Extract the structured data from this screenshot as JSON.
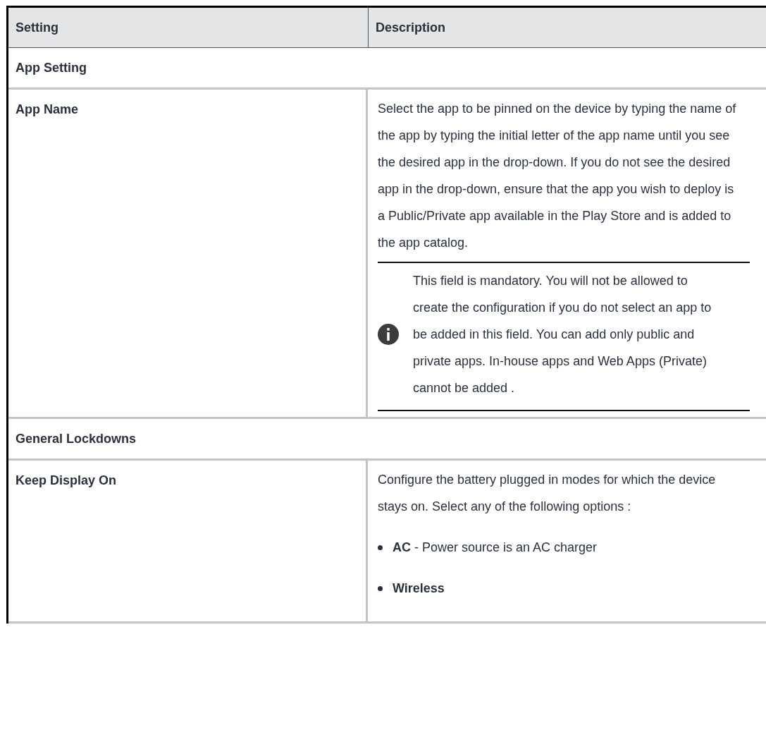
{
  "table": {
    "columns": [
      "Setting",
      "Description"
    ],
    "sections": [
      {
        "title": "App Setting",
        "rows": [
          {
            "setting": "App Name",
            "description": "Select the app to be pinned on the device by typing the name of the app by typing the initial letter of the app name until you see the desired app in the drop-down. If you do not see the desired app in the drop-down, ensure that the app you wish to deploy is a Public/Private app available in the Play Store and is added to the app catalog.",
            "note": "This field is mandatory. You will not be allowed to create the configuration if you do not select an app to be added in this field. You can add only public and private apps. In-house apps and Web Apps (Private) cannot be added ."
          }
        ]
      },
      {
        "title": "General Lockdowns",
        "rows": [
          {
            "setting": "Keep Display On",
            "description": "Configure the battery plugged in modes for which the device stays on. Select any of the following options :",
            "bullets": [
              {
                "term": "AC",
                "text": "- Power source is an AC charger"
              },
              {
                "term": "Wireless"
              }
            ]
          }
        ]
      }
    ]
  }
}
